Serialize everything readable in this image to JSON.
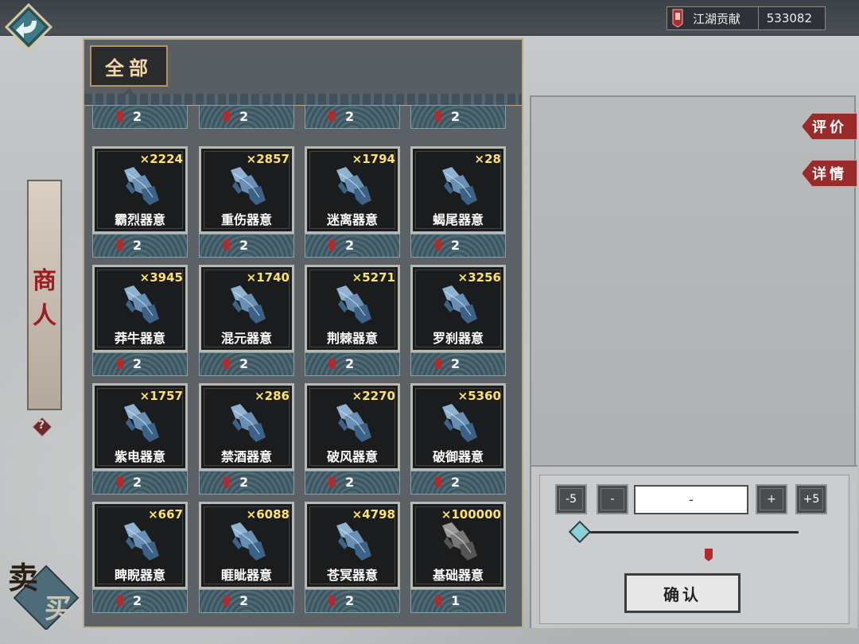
{
  "header": {
    "back_icon": "back-arrow-icon",
    "currency_label": "江湖贡献",
    "currency_value": "533082"
  },
  "tabs": {
    "all_label": "全部"
  },
  "side": {
    "merchant_label_1": "商",
    "merchant_label_2": "人",
    "help_label": "?"
  },
  "sellbuy": {
    "sell_label": "卖",
    "buy_label": "买"
  },
  "right_tabs": {
    "review_label": "评价",
    "details_label": "详情"
  },
  "quantity": {
    "minus5_label": "-5",
    "minus1_label": "-",
    "value": "-",
    "plus1_label": "+",
    "plus5_label": "+5",
    "confirm_label": "确认",
    "slider_level": 0
  },
  "partial_row": [
    {
      "price": "2"
    },
    {
      "price": "2"
    },
    {
      "price": "2"
    },
    {
      "price": "2"
    }
  ],
  "items": [
    {
      "name": "霸烈器意",
      "count": "×2224",
      "price": "2",
      "icon": "blue-crystal-icon"
    },
    {
      "name": "重伤器意",
      "count": "×2857",
      "price": "2",
      "icon": "blue-crystal-icon"
    },
    {
      "name": "迷离器意",
      "count": "×1794",
      "price": "2",
      "icon": "blue-crystal-icon"
    },
    {
      "name": "蝎尾器意",
      "count": "×28",
      "price": "2",
      "icon": "blue-crystal-icon"
    },
    {
      "name": "莽牛器意",
      "count": "×3945",
      "price": "2",
      "icon": "blue-crystal-icon"
    },
    {
      "name": "混元器意",
      "count": "×1740",
      "price": "2",
      "icon": "blue-crystal-icon"
    },
    {
      "name": "荆棘器意",
      "count": "×5271",
      "price": "2",
      "icon": "blue-crystal-icon"
    },
    {
      "name": "罗刹器意",
      "count": "×3256",
      "price": "2",
      "icon": "blue-crystal-icon"
    },
    {
      "name": "紫电器意",
      "count": "×1757",
      "price": "2",
      "icon": "blue-crystal-icon"
    },
    {
      "name": "禁酒器意",
      "count": "×286",
      "price": "2",
      "icon": "blue-crystal-icon"
    },
    {
      "name": "破风器意",
      "count": "×2270",
      "price": "2",
      "icon": "blue-crystal-icon"
    },
    {
      "name": "破御器意",
      "count": "×5360",
      "price": "2",
      "icon": "blue-crystal-icon"
    },
    {
      "name": "睥睨器意",
      "count": "×667",
      "price": "2",
      "icon": "blue-crystal-icon"
    },
    {
      "name": "睚眦器意",
      "count": "×6088",
      "price": "2",
      "icon": "blue-crystal-icon"
    },
    {
      "name": "苍冥器意",
      "count": "×4798",
      "price": "2",
      "icon": "blue-crystal-icon"
    },
    {
      "name": "基础器意",
      "count": "×100000",
      "price": "1",
      "icon": "gray-crystal-icon"
    }
  ],
  "colors": {
    "count_text": "#ffe26a",
    "token_red": "#b22a2a",
    "panel": "#5c6166"
  }
}
